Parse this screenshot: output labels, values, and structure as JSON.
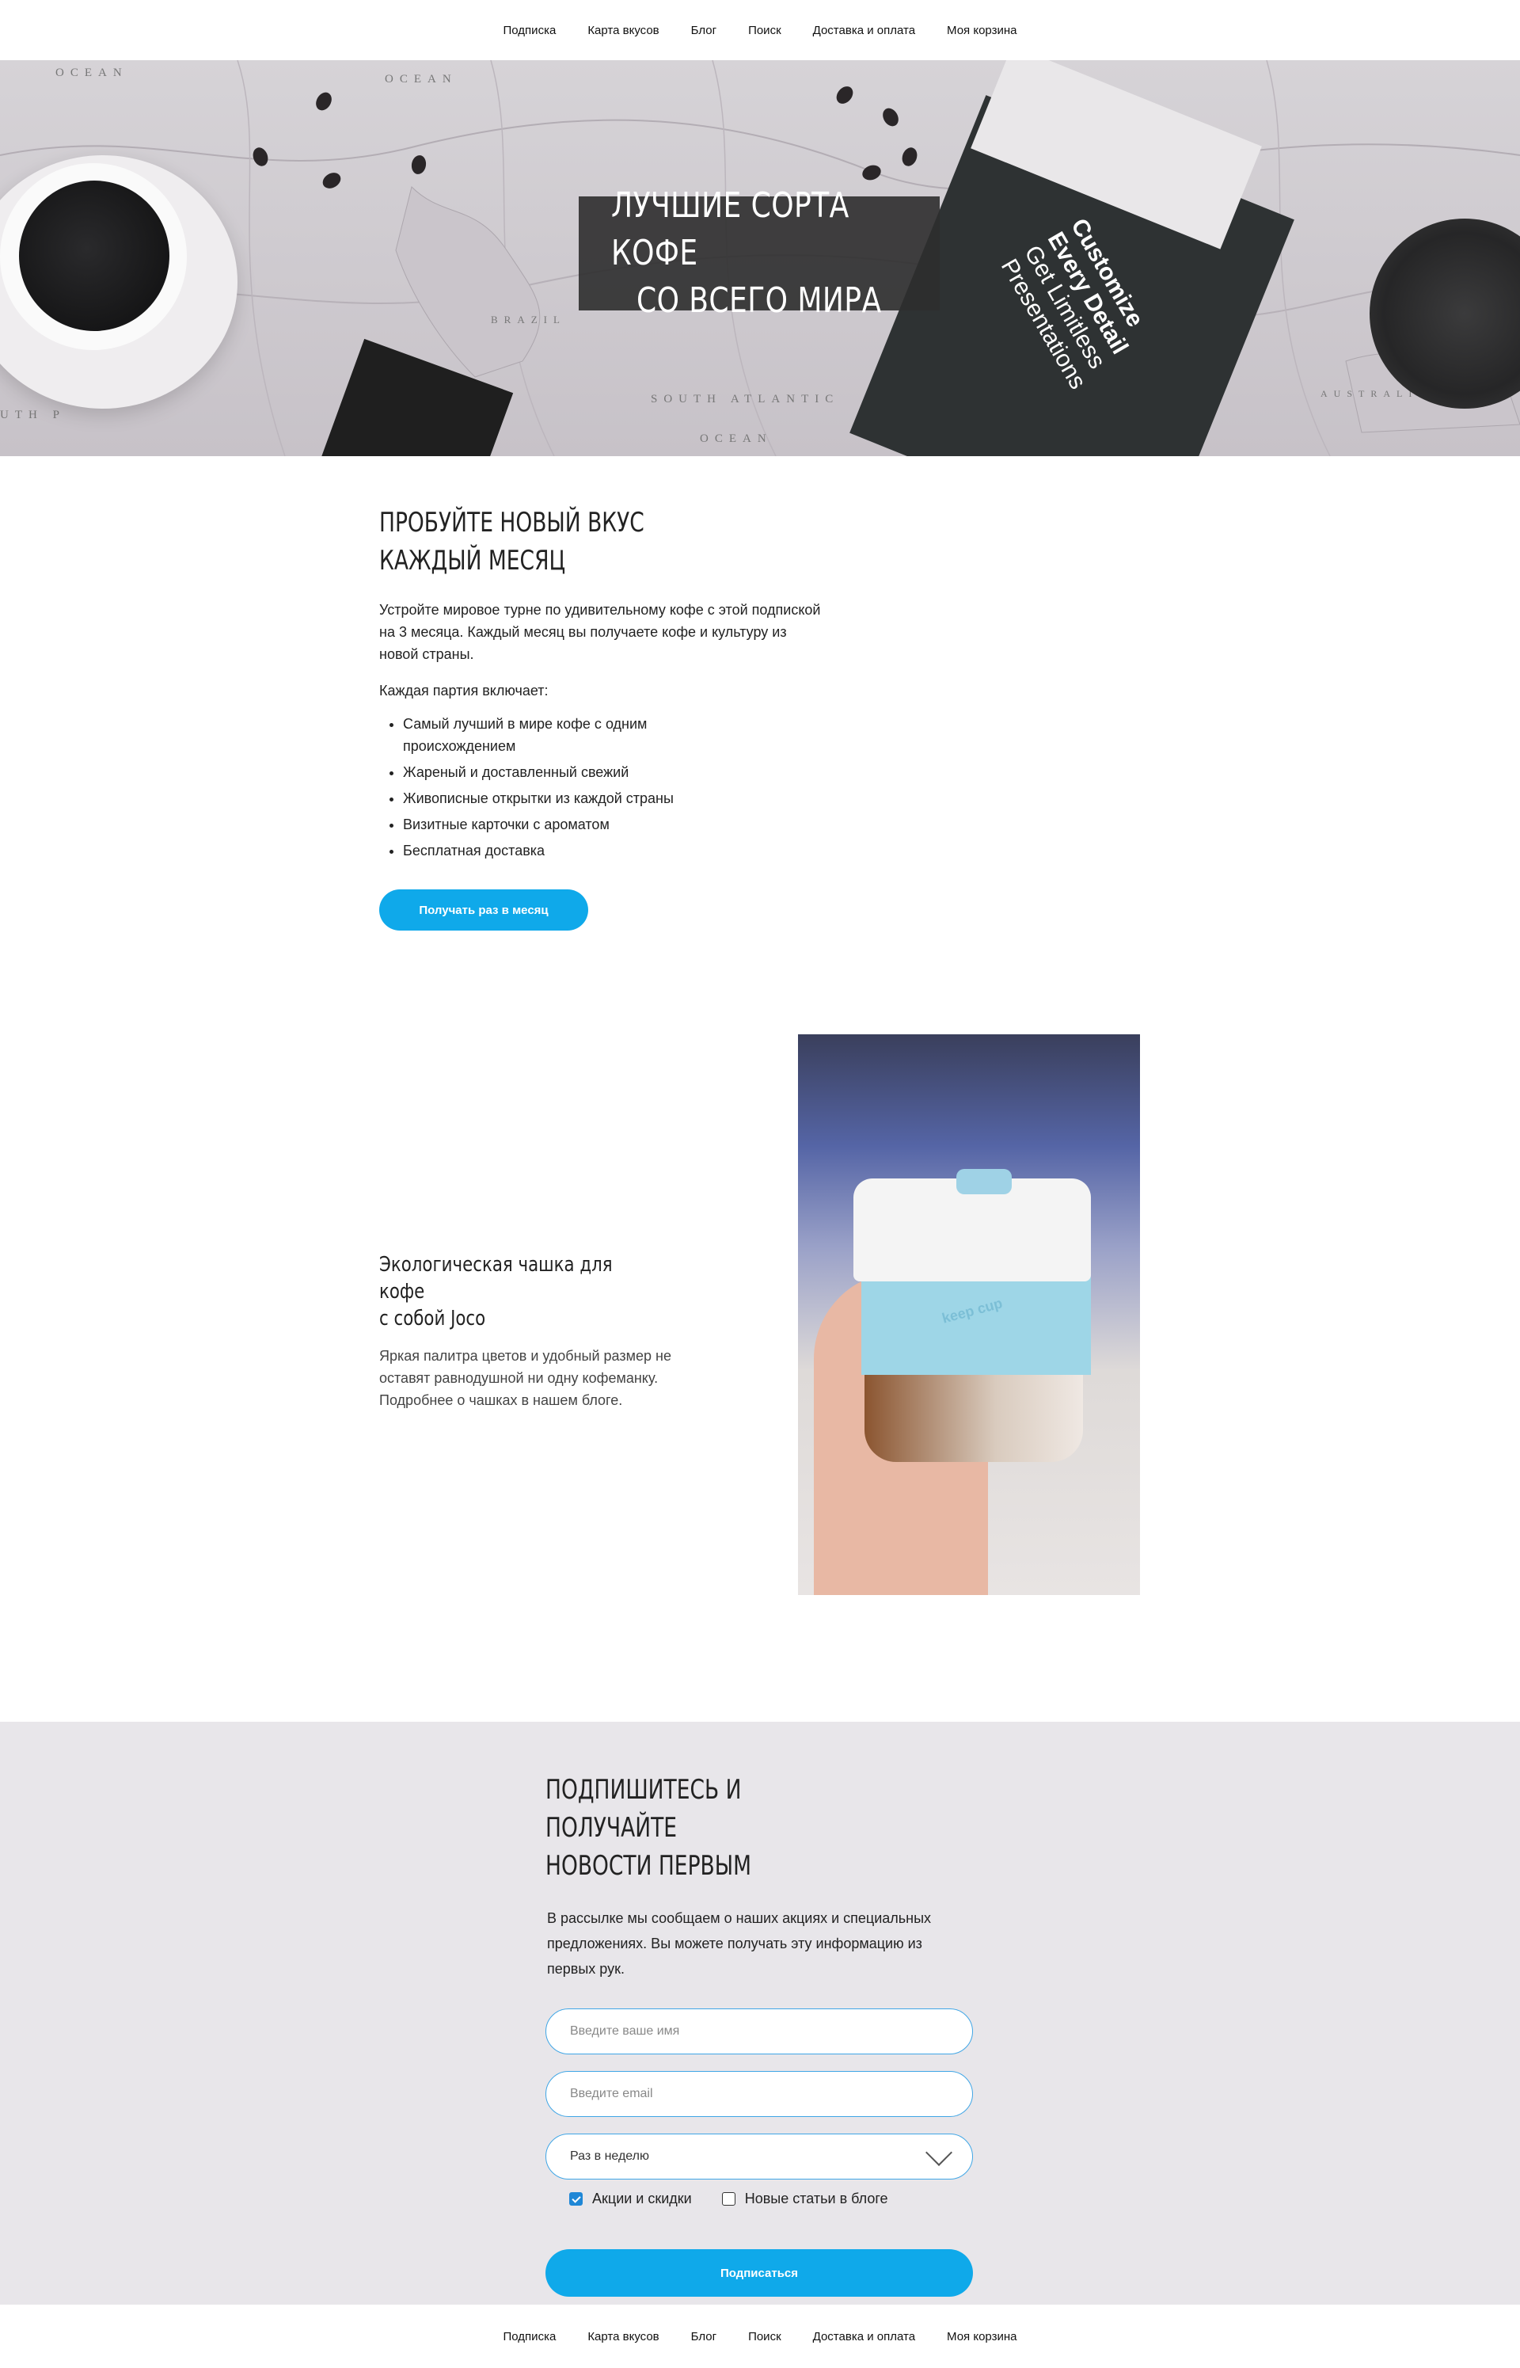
{
  "nav": {
    "items": [
      "Подписка",
      "Карта вкусов",
      "Блог",
      "Поиск",
      "Доставка и оплата",
      "Моя корзина"
    ]
  },
  "hero": {
    "title_line1": "ЛУЧШИЕ СОРТА КОФЕ",
    "title_line2": "СО ВСЕГО МИРА",
    "map_labels": [
      "OCEAN",
      "OCEAN",
      "BRAZIL",
      "SOUTH ATLANTIC",
      "OCEAN",
      "AUSTRALIA",
      "UTH P"
    ],
    "bag_text": [
      "Customize",
      "Every Detail",
      "Get Limitless",
      "Presentations"
    ]
  },
  "promo": {
    "title_line1": "ПРОБУЙТЕ НОВЫЙ ВКУС",
    "title_line2": "КАЖДЫЙ МЕСЯЦ",
    "description": "Устройте мировое турне по удивительному кофе с этой подпиской на 3 месяца. Каждый месяц вы получаете кофе и культуру из новой страны.",
    "includes_label": "Каждая партия включает:",
    "list": [
      "Самый лучший в мире кофе с одним происхождением",
      "Жареный и доставленный свежий",
      "Живописные открытки из каждой страны",
      "Визитные карточки с ароматом",
      "Бесплатная доставка"
    ],
    "button_label": "Получать раз в месяц"
  },
  "eco": {
    "title_line1": "Экологическая чашка для кофе",
    "title_line2": "с собой Joco",
    "description": "Яркая палитра цветов и удобный размер не оставят равнодушной ни одну кофеманку. Подробнее о чашках в нашем блоге.",
    "image_text": "keep cup"
  },
  "subscribe": {
    "title_line1": "ПОДПИШИТЕСЬ И ПОЛУЧАЙТЕ",
    "title_line2": "НОВОСТИ ПЕРВЫМ",
    "description": "В рассылке мы сообщаем о наших акциях и специальных предложениях. Вы можете получать эту информацию из первых рук.",
    "name_placeholder": "Введите ваше имя",
    "email_placeholder": "Введите email",
    "frequency_value": "Раз в неделю",
    "checkbox1_label": "Акции и скидки",
    "checkbox1_checked": true,
    "checkbox2_label": "Новые статьи в блоге",
    "checkbox2_checked": false,
    "submit_label": "Подписаться"
  },
  "footer": {
    "items": [
      "Подписка",
      "Карта вкусов",
      "Блог",
      "Поиск",
      "Доставка и оплата",
      "Моя корзина"
    ]
  },
  "colors": {
    "accent": "#0fa9ea",
    "subscribe_bg": "#e8e6ea",
    "hero_box": "#2d2d2d"
  }
}
